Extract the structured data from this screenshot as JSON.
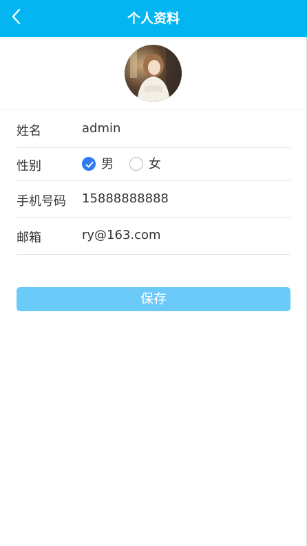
{
  "header": {
    "title": "个人资料",
    "back_icon": "chevron-left-icon",
    "background": "#03b5f0"
  },
  "profile": {
    "avatar_alt": "用户头像"
  },
  "fields": {
    "name": {
      "label": "姓名",
      "value": "admin"
    },
    "gender": {
      "label": "性别",
      "options": [
        {
          "label": "男",
          "checked": true
        },
        {
          "label": "女",
          "checked": false
        }
      ]
    },
    "phone": {
      "label": "手机号码",
      "value": "15888888888"
    },
    "email": {
      "label": "邮箱",
      "value": "ry@163.com"
    }
  },
  "actions": {
    "save_label": "保存",
    "save_color": "#6ccaf9"
  },
  "colors": {
    "radio_checked": "#2f7bf5",
    "text": "#333333"
  }
}
